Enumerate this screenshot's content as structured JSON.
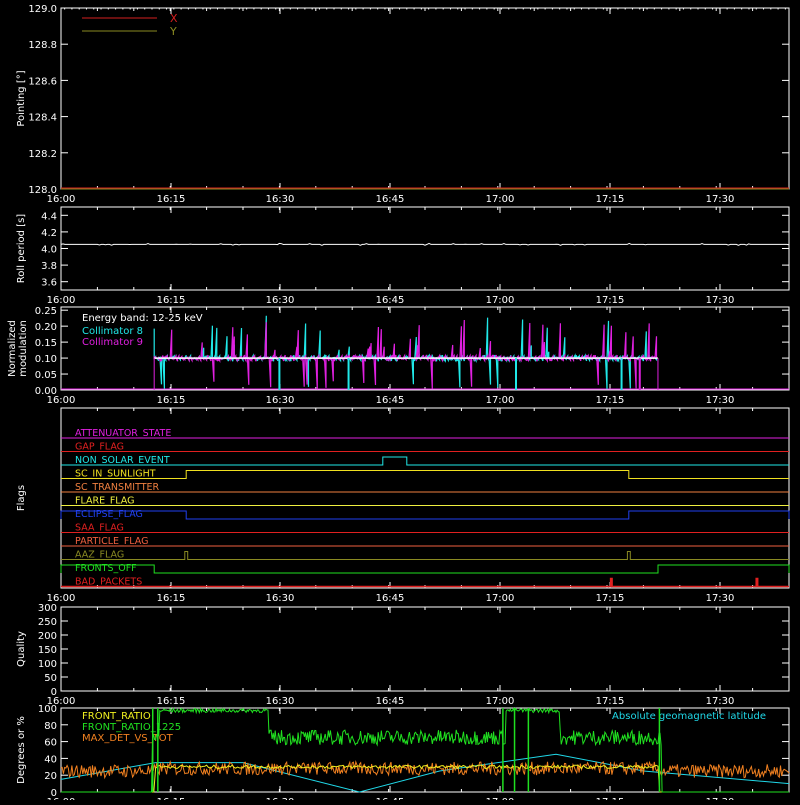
{
  "time_ticks": [
    "16:00",
    "16:15",
    "16:30",
    "16:45",
    "17:00",
    "17:15",
    "17:30"
  ],
  "chart_data": [
    {
      "type": "line",
      "ylabel": "Pointing [°]",
      "ylim": [
        128.0,
        129.0
      ],
      "yticks": [
        "128.0",
        "128.2",
        "128.4",
        "128.6",
        "128.8",
        "129.0"
      ],
      "xlim_minutes": [
        0,
        100
      ],
      "grid": false,
      "legend_position": "top-left",
      "series": [
        {
          "name": "X",
          "color": "#d42020",
          "x": [
            0,
            100
          ],
          "values": [
            128.0,
            128.0
          ]
        },
        {
          "name": "Y",
          "color": "#8a8a22",
          "x": [
            0,
            100
          ],
          "values": [
            128.0,
            128.0
          ]
        }
      ]
    },
    {
      "type": "line",
      "ylabel": "Roll period [s]",
      "ylim": [
        3.5,
        4.5
      ],
      "yticks": [
        "3.6",
        "3.8",
        "4.0",
        "4.2",
        "4.4"
      ],
      "xlim_minutes": [
        0,
        100
      ],
      "series": [
        {
          "color": "#ffffff",
          "x": [
            0,
            100
          ],
          "values": [
            4.05,
            4.05
          ]
        }
      ]
    },
    {
      "type": "line",
      "ylabel": "Normalized modulation",
      "ylim": [
        0,
        0.26
      ],
      "yticks": [
        "0.00",
        "0.05",
        "0.10",
        "0.15",
        "0.20",
        "0.25"
      ],
      "xlim_minutes": [
        0,
        100
      ],
      "annotation": "Energy band: 12-25 keV",
      "legend_position": "top-left",
      "series": [
        {
          "name": "Collimator 8",
          "color": "#20e8e8",
          "x": [
            0,
            12.8,
            12.8,
            82,
            82,
            100
          ],
          "values": [
            0,
            0,
            0.1,
            0.1,
            0,
            0
          ]
        },
        {
          "name": "Collimator 9",
          "color": "#e020e0",
          "x": [
            0,
            12.8,
            12.8,
            82,
            82,
            100
          ],
          "values": [
            0,
            0,
            0.1,
            0.1,
            0,
            0
          ]
        }
      ]
    },
    {
      "type": "line",
      "ylabel": "Flags",
      "xlim_minutes": [
        0,
        100
      ],
      "series": [
        {
          "name": "ATTENUATOR_STATE",
          "color": "#e020e0",
          "transitions": []
        },
        {
          "name": "GAP_FLAG",
          "color": "#e02020",
          "transitions": []
        },
        {
          "name": "NON_SOLAR_EVENT",
          "color": "#20e8e8",
          "transitions": [
            [
              44.2,
              47.5
            ]
          ]
        },
        {
          "name": "SC_IN_SUNLIGHT",
          "color": "#f0e020",
          "transitions": [
            [
              17.2,
              78
            ]
          ]
        },
        {
          "name": "SC_TRANSMITTER",
          "color": "#f08040",
          "transitions": []
        },
        {
          "name": "FLARE_FLAG",
          "color": "#f0f040",
          "transitions": []
        },
        {
          "name": "ECLIPSE_FLAG",
          "color": "#2040f0",
          "transitions": [
            [
              0,
              17.2
            ],
            [
              78,
              100
            ]
          ]
        },
        {
          "name": "SAA_FLAG",
          "color": "#e02020",
          "transitions": []
        },
        {
          "name": "PARTICLE_FLAG",
          "color": "#f06040",
          "transitions": []
        },
        {
          "name": "AAZ_FLAG",
          "color": "#8a8a22",
          "transitions": [
            [
              17.0,
              17.4
            ],
            [
              77.8,
              78.2
            ]
          ]
        },
        {
          "name": "FRONTS_OFF",
          "color": "#20e020",
          "transitions": [
            [
              0,
              12.8
            ],
            [
              82,
              100
            ]
          ]
        },
        {
          "name": "BAD_PACKETS",
          "color": "#e02020",
          "transitions": [
            [
              75.5,
              75.7
            ],
            [
              95.5,
              95.7
            ]
          ]
        }
      ]
    },
    {
      "type": "line",
      "ylabel": "Quality",
      "ylim": [
        0,
        300
      ],
      "yticks": [
        "0",
        "50",
        "100",
        "150",
        "200",
        "250",
        "300"
      ],
      "xlim_minutes": [
        0,
        100
      ],
      "series": []
    },
    {
      "type": "line",
      "ylabel": "Degrees or %",
      "ylim": [
        0,
        100
      ],
      "yticks": [
        "0",
        "20",
        "40",
        "60",
        "80",
        "100"
      ],
      "xlim_minutes": [
        0,
        100
      ],
      "legend_position": "top-left",
      "series": [
        {
          "name": "FRONT_RATIO",
          "color": "#f0f020",
          "x": [
            0,
            12.8,
            12.8,
            82,
            82,
            100
          ],
          "values": [
            0,
            0,
            30,
            30,
            0,
            0
          ]
        },
        {
          "name": "FRONT_RATIO_1225",
          "color": "#20e020",
          "x": [
            0,
            12.5,
            13.5,
            28.5,
            29,
            60.5,
            61,
            68.5,
            69,
            82,
            82.5,
            100
          ],
          "values": [
            0,
            0,
            100,
            100,
            65,
            65,
            100,
            100,
            65,
            65,
            0,
            0
          ]
        },
        {
          "name": "MAX_DET_VS_TOT",
          "color": "#f08020",
          "x": [
            0,
            100
          ],
          "values": [
            25,
            25
          ]
        },
        {
          "name": "Absolute geomagnetic latitude",
          "color": "#20d8e8",
          "x": [
            0,
            13,
            25,
            41,
            52,
            68,
            80,
            100
          ],
          "values": [
            15,
            35,
            35,
            0,
            25,
            45,
            25,
            10
          ]
        }
      ]
    }
  ]
}
